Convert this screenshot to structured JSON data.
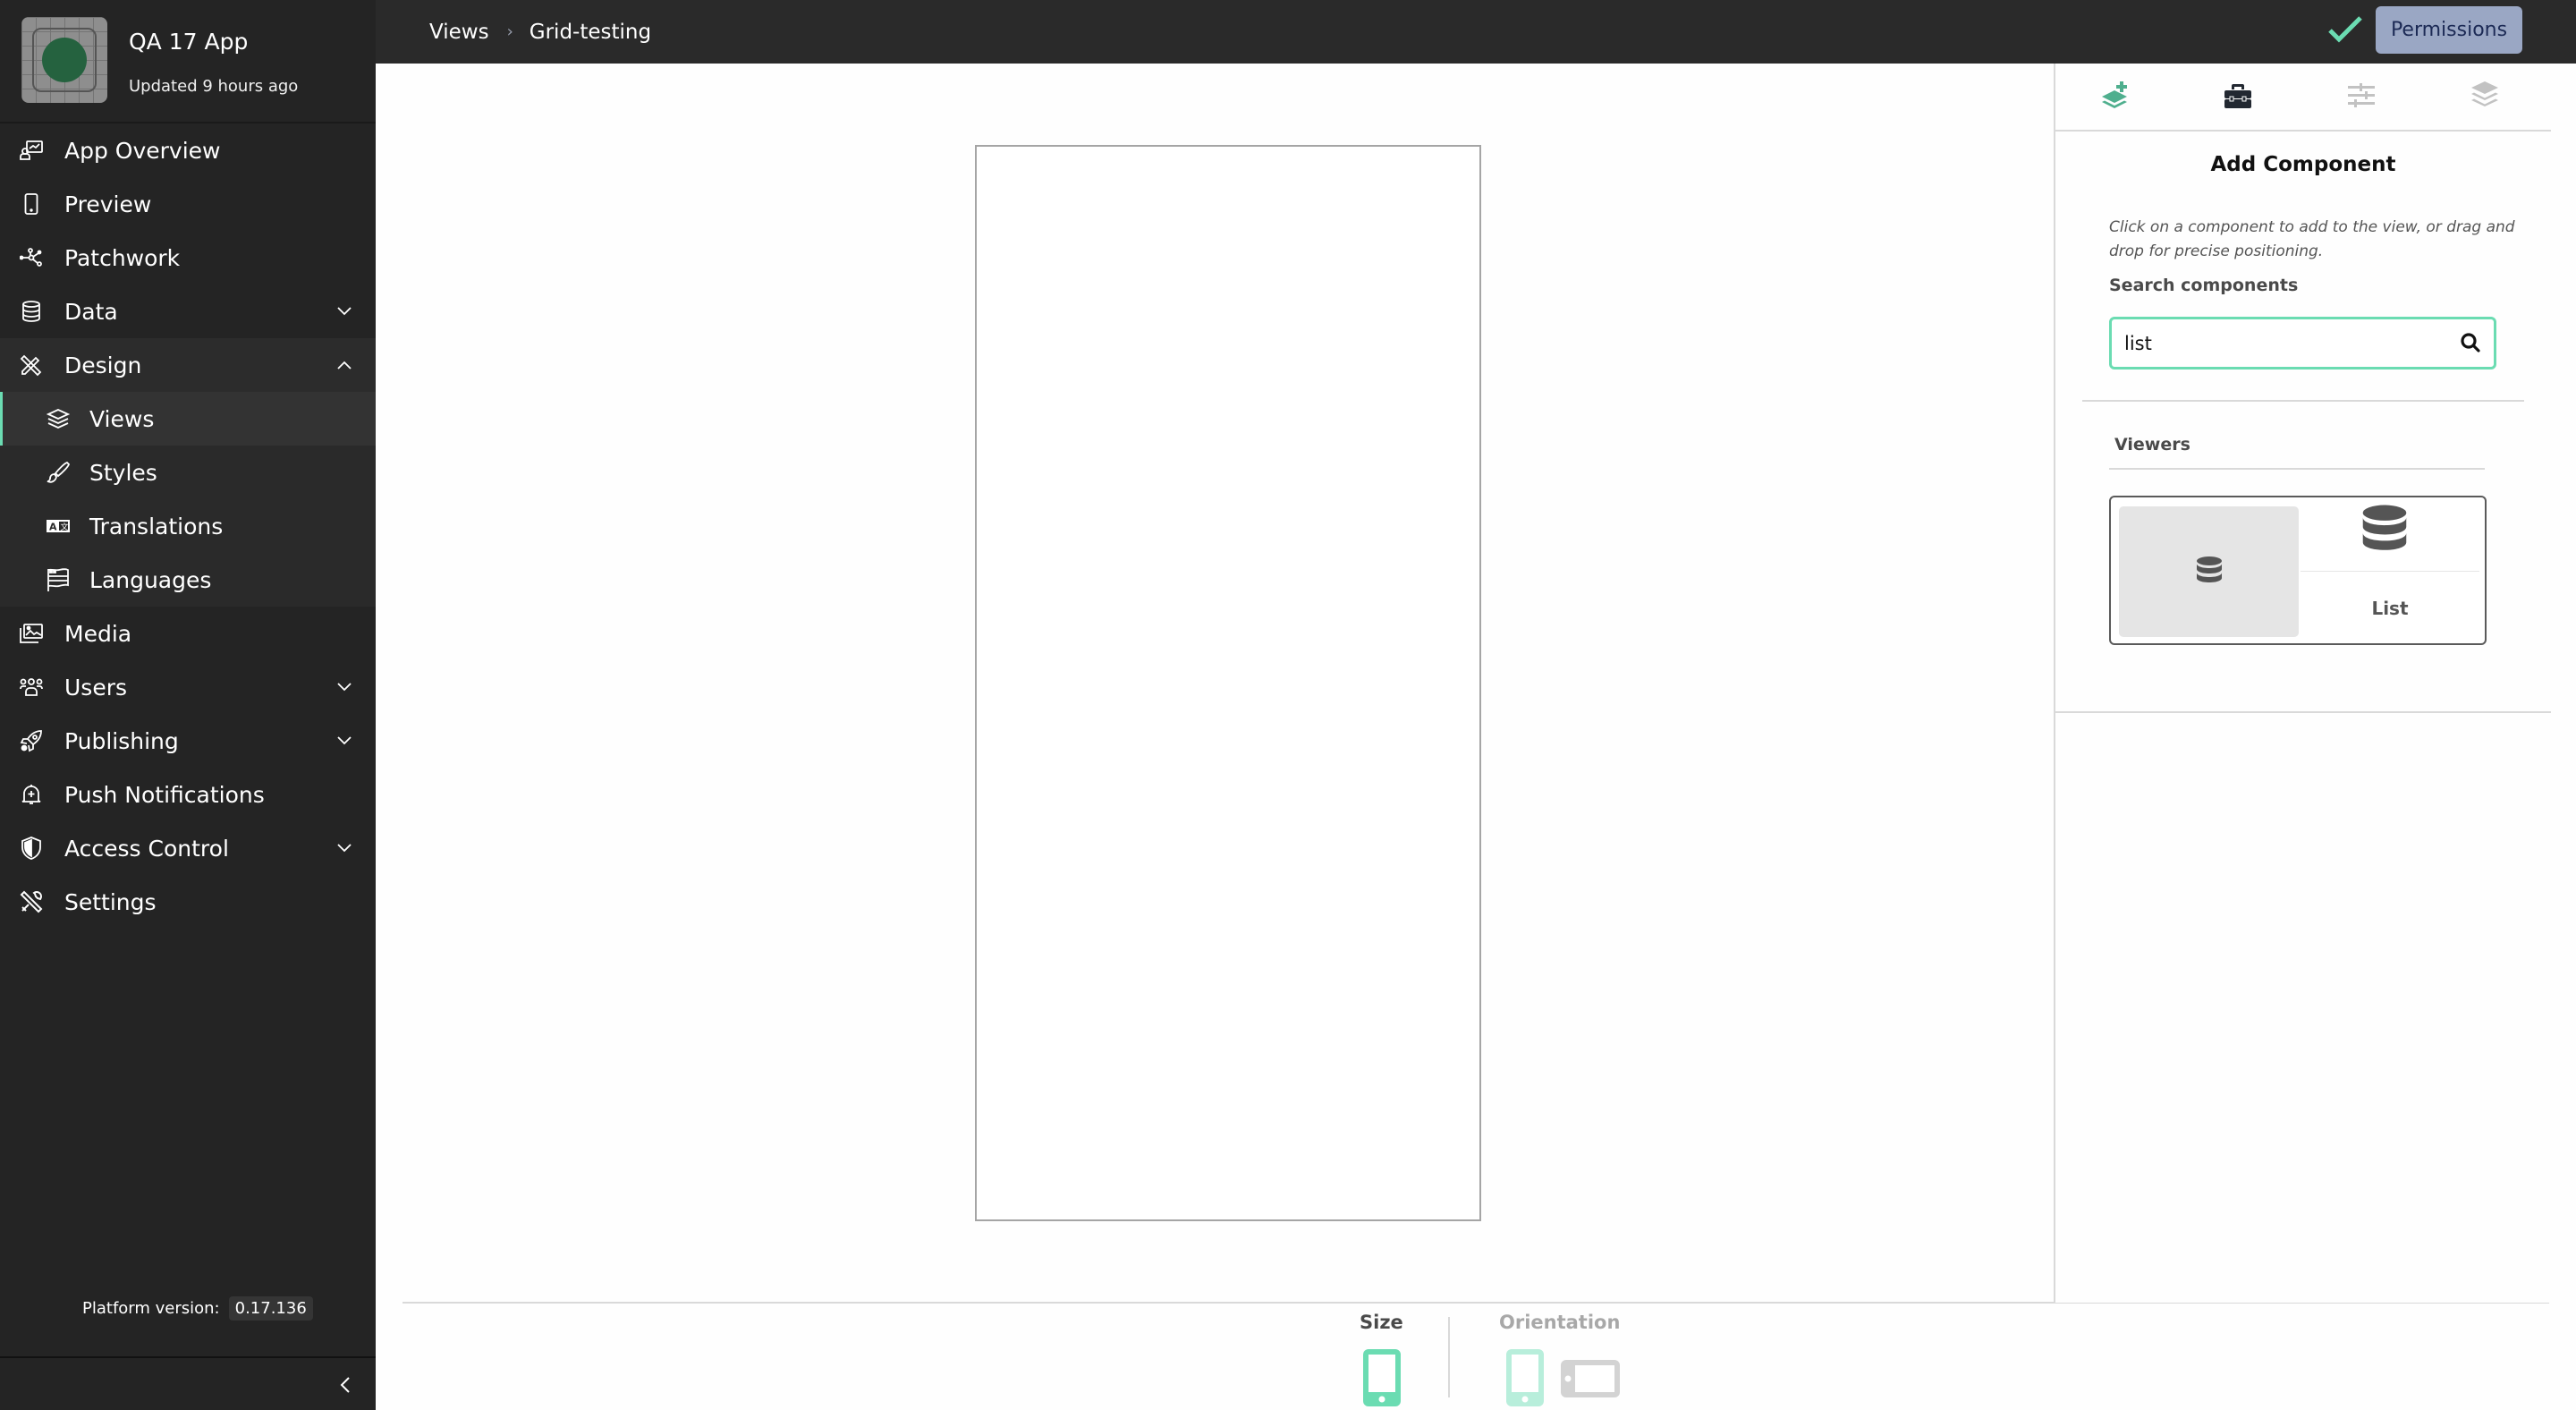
{
  "app": {
    "title": "QA 17 App",
    "updated": "Updated 9 hours ago"
  },
  "sidebar": {
    "items": [
      {
        "label": "App Overview",
        "icon": "app-overview-icon"
      },
      {
        "label": "Preview",
        "icon": "phone-icon"
      },
      {
        "label": "Patchwork",
        "icon": "patchwork-icon"
      },
      {
        "label": "Data",
        "icon": "database-icon",
        "expandable": true,
        "expanded": false
      },
      {
        "label": "Design",
        "icon": "design-icon",
        "expandable": true,
        "expanded": true
      },
      {
        "label": "Media",
        "icon": "media-icon"
      },
      {
        "label": "Users",
        "icon": "users-icon",
        "expandable": true,
        "expanded": false
      },
      {
        "label": "Publishing",
        "icon": "rocket-icon",
        "expandable": true,
        "expanded": false
      },
      {
        "label": "Push Notifications",
        "icon": "bell-icon"
      },
      {
        "label": "Access Control",
        "icon": "shield-icon",
        "expandable": true,
        "expanded": false
      },
      {
        "label": "Settings",
        "icon": "settings-icon"
      }
    ],
    "design_sub": [
      {
        "label": "Views",
        "icon": "layers-icon",
        "active": true
      },
      {
        "label": "Styles",
        "icon": "brush-icon"
      },
      {
        "label": "Translations",
        "icon": "translate-icon"
      },
      {
        "label": "Languages",
        "icon": "flag-icon"
      }
    ],
    "platform_label": "Platform version:",
    "platform_version": "0.17.136"
  },
  "topbar": {
    "breadcrumb": [
      "Views",
      "Grid-testing"
    ],
    "breadcrumb_separator": "›",
    "saved_status": "check-icon",
    "permissions_label": "Permissions"
  },
  "colors": {
    "accent": "#6bdcb2",
    "sidebar_bg": "#242424",
    "topbar_bg": "#2a2a2a",
    "permissions_bg": "#9aa7c4"
  },
  "right_panel": {
    "tabs": [
      {
        "name": "add-component",
        "icon": "layer-plus-icon",
        "state": "accent"
      },
      {
        "name": "toolbox",
        "icon": "toolbox-icon",
        "state": "active"
      },
      {
        "name": "properties",
        "icon": "sliders-icon",
        "state": "inactive"
      },
      {
        "name": "layers",
        "icon": "layers-icon",
        "state": "inactive"
      }
    ],
    "title": "Add Component",
    "help": "Click on a component to add to the view, or drag and drop for precise positioning.",
    "search_label": "Search components",
    "search_value": "list",
    "section": "Viewers",
    "components": [
      {
        "name": "List",
        "icon": "database-icon"
      }
    ]
  },
  "bottom": {
    "size_label": "Size",
    "orientation_label": "Orientation",
    "size_selected": "phone",
    "orientation_selected": "portrait"
  }
}
